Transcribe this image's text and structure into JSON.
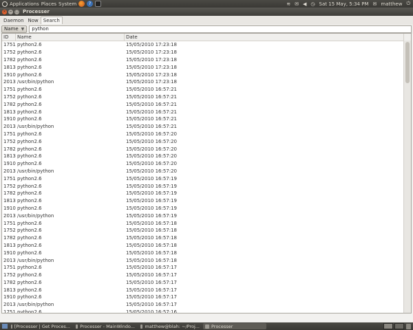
{
  "top_panel": {
    "menus": [
      "Applications",
      "Places",
      "System"
    ],
    "clock": "Sat 15 May,  5:34 PM",
    "user": "matthew"
  },
  "window": {
    "title": "Processer",
    "tabs": [
      "Daemon",
      "Now",
      "Search"
    ],
    "active_tab": "Search",
    "filter_field": "Name",
    "search_value": "python"
  },
  "table": {
    "columns": [
      "ID",
      "Name",
      "Date"
    ],
    "rows": [
      [
        "1751",
        "python2.6",
        "15/05/2010 17:23:18"
      ],
      [
        "1752",
        "python2.6",
        "15/05/2010 17:23:18"
      ],
      [
        "1782",
        "python2.6",
        "15/05/2010 17:23:18"
      ],
      [
        "1813",
        "python2.6",
        "15/05/2010 17:23:18"
      ],
      [
        "1910",
        "python2.6",
        "15/05/2010 17:23:18"
      ],
      [
        "2013",
        "/usr/bin/python",
        "15/05/2010 17:23:18"
      ],
      [
        "1751",
        "python2.6",
        "15/05/2010 16:57:21"
      ],
      [
        "1752",
        "python2.6",
        "15/05/2010 16:57:21"
      ],
      [
        "1782",
        "python2.6",
        "15/05/2010 16:57:21"
      ],
      [
        "1813",
        "python2.6",
        "15/05/2010 16:57:21"
      ],
      [
        "1910",
        "python2.6",
        "15/05/2010 16:57:21"
      ],
      [
        "2013",
        "/usr/bin/python",
        "15/05/2010 16:57:21"
      ],
      [
        "1751",
        "python2.6",
        "15/05/2010 16:57:20"
      ],
      [
        "1752",
        "python2.6",
        "15/05/2010 16:57:20"
      ],
      [
        "1782",
        "python2.6",
        "15/05/2010 16:57:20"
      ],
      [
        "1813",
        "python2.6",
        "15/05/2010 16:57:20"
      ],
      [
        "1910",
        "python2.6",
        "15/05/2010 16:57:20"
      ],
      [
        "2013",
        "/usr/bin/python",
        "15/05/2010 16:57:20"
      ],
      [
        "1751",
        "python2.6",
        "15/05/2010 16:57:19"
      ],
      [
        "1752",
        "python2.6",
        "15/05/2010 16:57:19"
      ],
      [
        "1782",
        "python2.6",
        "15/05/2010 16:57:19"
      ],
      [
        "1813",
        "python2.6",
        "15/05/2010 16:57:19"
      ],
      [
        "1910",
        "python2.6",
        "15/05/2010 16:57:19"
      ],
      [
        "2013",
        "/usr/bin/python",
        "15/05/2010 16:57:19"
      ],
      [
        "1751",
        "python2.6",
        "15/05/2010 16:57:18"
      ],
      [
        "1752",
        "python2.6",
        "15/05/2010 16:57:18"
      ],
      [
        "1782",
        "python2.6",
        "15/05/2010 16:57:18"
      ],
      [
        "1813",
        "python2.6",
        "15/05/2010 16:57:18"
      ],
      [
        "1910",
        "python2.6",
        "15/05/2010 16:57:18"
      ],
      [
        "2013",
        "/usr/bin/python",
        "15/05/2010 16:57:18"
      ],
      [
        "1751",
        "python2.6",
        "15/05/2010 16:57:17"
      ],
      [
        "1752",
        "python2.6",
        "15/05/2010 16:57:17"
      ],
      [
        "1782",
        "python2.6",
        "15/05/2010 16:57:17"
      ],
      [
        "1813",
        "python2.6",
        "15/05/2010 16:57:17"
      ],
      [
        "1910",
        "python2.6",
        "15/05/2010 16:57:17"
      ],
      [
        "2013",
        "/usr/bin/python",
        "15/05/2010 16:57:17"
      ],
      [
        "1751",
        "python2.6",
        "15/05/2010 16:57:16"
      ]
    ]
  },
  "taskbar": {
    "tasks": [
      {
        "label": "[Processer | Get Proces...",
        "active": false
      },
      {
        "label": "Processer - MainWindo...",
        "active": false
      },
      {
        "label": "matthew@blah: ~/Proj...",
        "active": false
      },
      {
        "label": "Processer",
        "active": true
      }
    ]
  },
  "colors": {
    "panel_bg": "#3c3b37",
    "close_button": "#e05f2d",
    "window_bg": "#f2f1ef"
  }
}
